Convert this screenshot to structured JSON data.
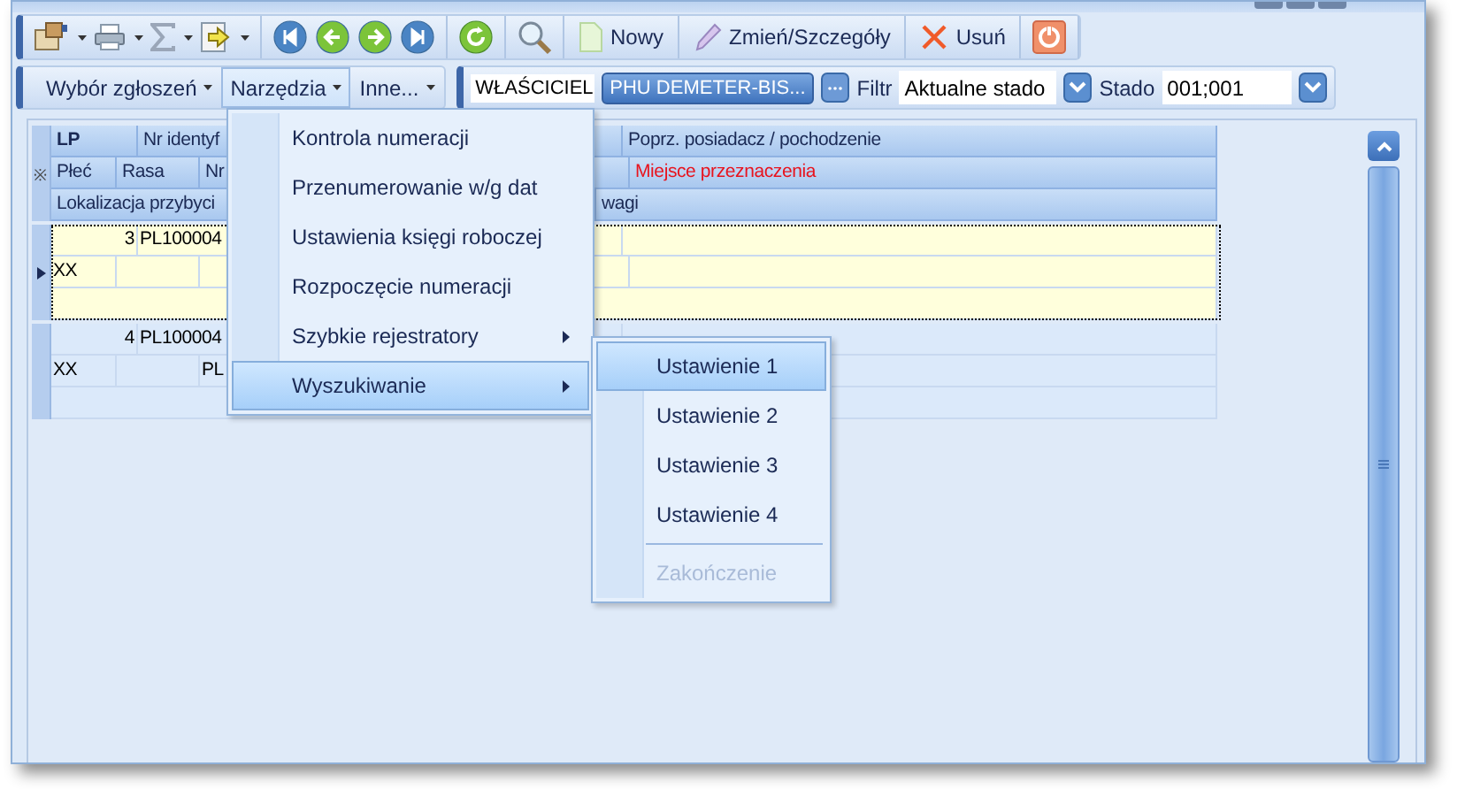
{
  "toolbar": {
    "tools": [
      {
        "kind": "card"
      },
      {
        "kind": "printer"
      },
      {
        "kind": "sum"
      },
      {
        "kind": "export"
      }
    ],
    "navigation": [
      {
        "kind": "first"
      },
      {
        "kind": "previous"
      },
      {
        "kind": "next"
      },
      {
        "kind": "last"
      }
    ],
    "actions": [
      {
        "kind": "refresh"
      },
      {
        "kind": "search"
      },
      {
        "kind": "new",
        "label": "Nowy"
      },
      {
        "kind": "edit",
        "label": "Zmień/Szczegóły"
      },
      {
        "kind": "delete",
        "label": "Usuń"
      },
      {
        "kind": "close"
      }
    ]
  },
  "menubar": [
    {
      "label": "Wybór zgłoszeń",
      "selected": false
    },
    {
      "label": "Narzędzia",
      "selected": true
    },
    {
      "label": "Inne...",
      "selected": false
    }
  ],
  "filters": {
    "owner_label": "WŁAŚCICIEL",
    "owner_value": "PHU DEMETER-BIS...",
    "filter_label": "Filtr",
    "filter_value": "Aktualne stado",
    "herd_label": "Stado",
    "herd_value": "001;001"
  },
  "grid": {
    "header": {
      "lp": "LP",
      "id": "Nr identyf",
      "prev_owner": "Poprz. posiadacz / pochodzenie",
      "new_row_mark": "※",
      "sex": "Płeć",
      "breed": "Rasa",
      "nr": "Nr",
      "destination": "Miejsce przeznaczenia",
      "location": "Lokalizacja przybyci",
      "notes": "wagi"
    },
    "rows": [
      {
        "selected": true,
        "lp": "3",
        "id": "PL100004",
        "sex": "XX"
      },
      {
        "selected": false,
        "lp": "4",
        "id": "PL100004",
        "sex": "XX",
        "nr": "PL"
      }
    ]
  },
  "menu": [
    {
      "label": "Kontrola numeracji",
      "submenu": false,
      "selected": false
    },
    {
      "label": "Przenumerowanie w/g dat",
      "submenu": false,
      "selected": false
    },
    {
      "label": "Ustawienia księgi roboczej",
      "submenu": false,
      "selected": false
    },
    {
      "label": "Rozpoczęcie numeracji",
      "submenu": false,
      "selected": false
    },
    {
      "label": "Szybkie rejestratory",
      "submenu": true,
      "selected": false
    },
    {
      "label": "Wyszukiwanie",
      "submenu": true,
      "selected": true
    }
  ],
  "submenu": [
    {
      "kind": "item",
      "label": "Ustawienie 1",
      "selected": true,
      "disabled": false
    },
    {
      "kind": "item",
      "label": "Ustawienie 2",
      "selected": false,
      "disabled": false
    },
    {
      "kind": "item",
      "label": "Ustawienie 3",
      "selected": false,
      "disabled": false
    },
    {
      "kind": "item",
      "label": "Ustawienie 4",
      "selected": false,
      "disabled": false
    },
    {
      "kind": "separator"
    },
    {
      "kind": "item",
      "label": "Zakończenie",
      "selected": false,
      "disabled": true
    }
  ]
}
